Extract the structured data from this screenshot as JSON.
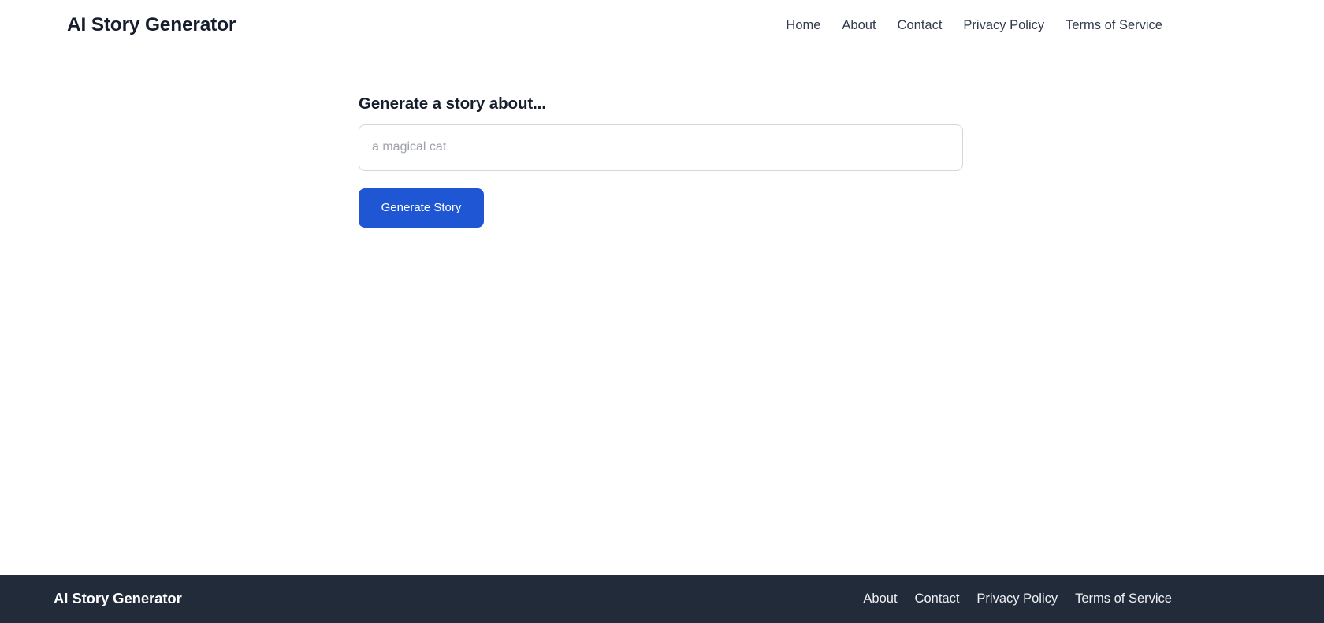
{
  "header": {
    "brand": "AI Story Generator",
    "nav": [
      {
        "label": "Home"
      },
      {
        "label": "About"
      },
      {
        "label": "Contact"
      },
      {
        "label": "Privacy Policy"
      },
      {
        "label": "Terms of Service"
      }
    ]
  },
  "main": {
    "form": {
      "label": "Generate a story about...",
      "input_value": "",
      "input_placeholder": "a magical cat",
      "submit_label": "Generate Story"
    }
  },
  "footer": {
    "brand": "AI Story Generator",
    "nav": [
      {
        "label": "About"
      },
      {
        "label": "Contact"
      },
      {
        "label": "Privacy Policy"
      },
      {
        "label": "Terms of Service"
      }
    ]
  },
  "colors": {
    "accent": "#1f56d3",
    "footer_bg": "#222b3a",
    "heading": "#161d2d",
    "nav_text": "#2f3a4d",
    "input_border": "#d6d7de",
    "placeholder": "#9ea1ab",
    "page_bg": "#ffffff"
  }
}
